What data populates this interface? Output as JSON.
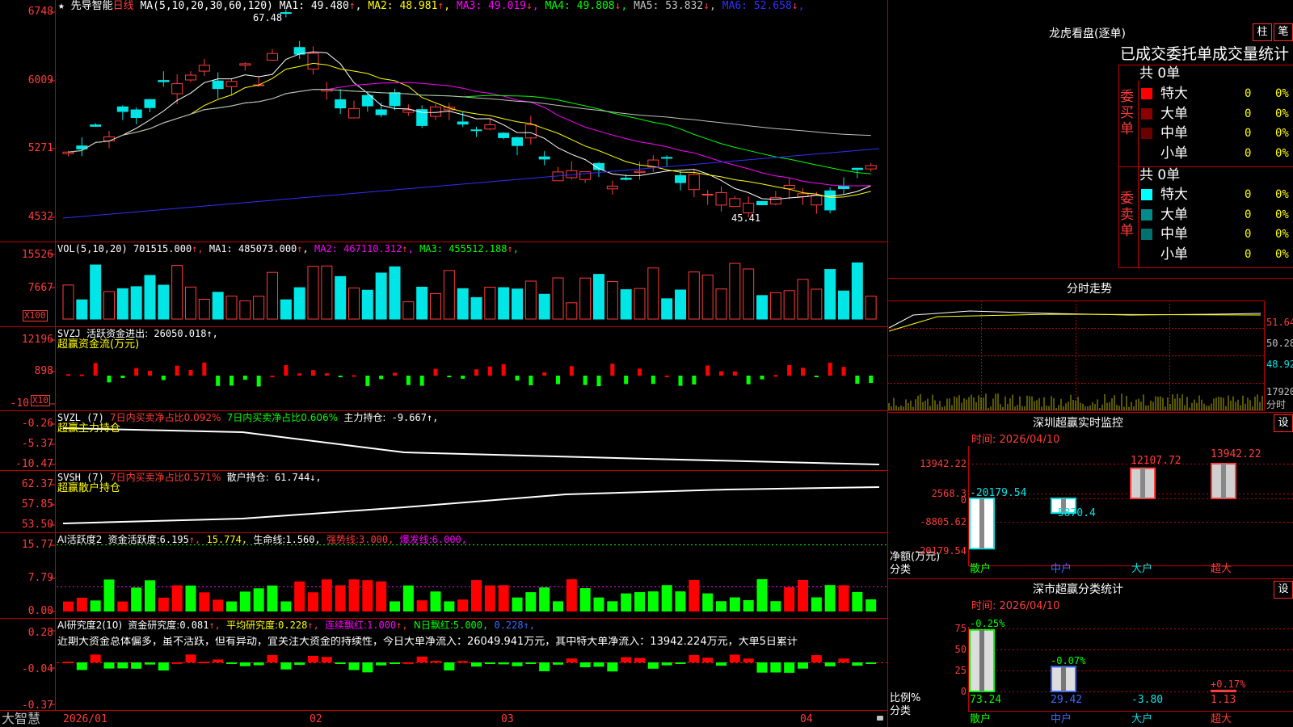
{
  "colors": {
    "up": "#ff3b3b",
    "down": "#00e5e5",
    "grid": "#c00000",
    "ma1": "#ffffff",
    "ma2": "#ffff00",
    "ma3": "#ff00ff",
    "ma4": "#00ff00",
    "ma5": "#c0c0c0",
    "ma6": "#3030ff"
  },
  "main": {
    "axis": [
      "6748",
      "6009",
      "5271",
      "4532"
    ],
    "star": "★",
    "title": "先导智能",
    "period": "日线",
    "ma_head": "MA(5,10,20,30,60,120)",
    "ma": [
      {
        "label": "MA1:",
        "value": "49.480",
        "arrow": "↑"
      },
      {
        "label": "MA2:",
        "value": "48.981",
        "arrow": "↑"
      },
      {
        "label": "MA3:",
        "value": "49.019",
        "arrow": "↓"
      },
      {
        "label": "MA4:",
        "value": "49.808",
        "arrow": "↓"
      },
      {
        "label": "MA5:",
        "value": "53.832",
        "arrow": "↓"
      },
      {
        "label": "MA6:",
        "value": "52.658",
        "arrow": "↓"
      }
    ],
    "high_mark": "67.48",
    "low_mark": "45.41"
  },
  "vol": {
    "axis": [
      "15526",
      "7667"
    ],
    "multiplier": "X100",
    "head": "VOL(5,10,20)",
    "value": "701515.000",
    "ma": [
      {
        "label": "MA1:",
        "value": "485073.000",
        "arrow": "↑"
      },
      {
        "label": "MA2:",
        "value": "467110.312",
        "arrow": "↑"
      },
      {
        "label": "MA3:",
        "value": "455512.188",
        "arrow": "↑"
      }
    ]
  },
  "svzj": {
    "axis": [
      "12196",
      "898",
      "-10"
    ],
    "multiplier": "X10",
    "head": "SVZJ",
    "label": "活跃资金进出:",
    "value": "26050.018",
    "arrow": "↑,",
    "sub": "超赢资金流(万元)"
  },
  "svzl": {
    "axis": [
      "-0.26",
      "-5.37",
      "-10.47"
    ],
    "head": "SVZL (7)",
    "t1": "7日内买卖净占比0.092%",
    "t2": "7日内买卖净占比0.606%",
    "label": "主力持仓:",
    "value": "-9.667",
    "arrow": "↑,",
    "sub": "超赢主力持仓"
  },
  "svsh": {
    "axis": [
      "62.37",
      "57.85",
      "53.50"
    ],
    "head": "SVSH (7)",
    "t1": "7日内买卖净占比0.571%",
    "label": "散户持仓:",
    "value": "61.744",
    "arrow": "↓,",
    "sub": "超赢散户持仓"
  },
  "ai1": {
    "axis": [
      "15.77",
      "7.79",
      "0.00"
    ],
    "head": "AI活跃度2",
    "l1": "资金活跃度:",
    "v1": "6.195",
    "a1": "↑,",
    "v2": "15.774",
    "a2": ",",
    "l3": "生命线:",
    "v3": "1.560",
    "a3": ",",
    "l4": "强势线:",
    "v4": "3.000",
    "a4": ",",
    "l5": "爆发线:",
    "v5": "6.000",
    "a5": ","
  },
  "ai2": {
    "axis": [
      "0.28",
      "-0.04",
      "-0.37"
    ],
    "head": "AI研究度2(10)",
    "l1": "资金研究度:",
    "v1": "0.081",
    "a1": "↑,",
    "l2": "平均研究度:",
    "v2": "0.228",
    "a2": "↑,",
    "l3": "连续飘红:",
    "v3": "1.000",
    "a3": "↑,",
    "l4": "N日飘红:",
    "v4": "5.000",
    "a4": ",",
    "v5": "0.228",
    "a5": "↑,",
    "note": "近期大资金总体偏多，虽不活跃，但有异动，宜关注大资金的持续性，今日大单净流入：26049.941万元，其中特大单净流入：13942.224万元，大单5日累计"
  },
  "xaxis": {
    "brand": "大智慧",
    "labels": [
      "2026/01",
      "02",
      "03",
      "04"
    ]
  },
  "lhb": {
    "title": "龙虎看盘(逐单)",
    "btn_zhu": "柱",
    "btn_bi": "笔",
    "header": "已成交委托单成交量统计",
    "buy_label": "委买单",
    "sell_label": "委卖单",
    "buy_total": "共 0单",
    "sell_total": "共 0单",
    "buy_rows": [
      {
        "name": "特大",
        "count": "0",
        "pct": "0%",
        "color": "#ff0000"
      },
      {
        "name": "大单",
        "count": "0",
        "pct": "0%",
        "color": "#8b0000"
      },
      {
        "name": "中单",
        "count": "0",
        "pct": "0%",
        "color": "#6b0000"
      },
      {
        "name": "小单",
        "count": "0",
        "pct": "0%",
        "color": ""
      }
    ],
    "sell_rows": [
      {
        "name": "特大",
        "count": "0",
        "pct": "0%",
        "color": "#00ffff"
      },
      {
        "name": "大单",
        "count": "0",
        "pct": "0%",
        "color": "#008b8b"
      },
      {
        "name": "中单",
        "count": "0",
        "pct": "0%",
        "color": "#007070"
      },
      {
        "name": "小单",
        "count": "0",
        "pct": "0%",
        "color": ""
      }
    ]
  },
  "fenshi": {
    "title": "分时走势",
    "axis": [
      "51.64",
      "50.28",
      "48.92",
      "17920"
    ],
    "unit": "分时"
  },
  "sz_monitor": {
    "title": "深圳超赢实时监控",
    "set": "设",
    "time": "时间: 2026/04/10",
    "axis": [
      "13942.22",
      "2568.3",
      "0",
      "-8805.62",
      "-20179.54"
    ],
    "ylabel": "净额(万元)",
    "xlabel": "分类",
    "categories": [
      "散户",
      "中户",
      "大户",
      "超大"
    ],
    "values": [
      -20179.54,
      -5870.4,
      12107.72,
      13942.22
    ],
    "value_labels": [
      "-20179.54",
      "-5870.4",
      "12107.72",
      "13942.22"
    ]
  },
  "sz_class": {
    "title": "深市超赢分类统计",
    "set": "设",
    "time": "时间: 2026/04/10",
    "axis": [
      "75",
      "50",
      "25",
      "0"
    ],
    "ylabel": "比例%",
    "xlabel": "分类",
    "categories": [
      "散户",
      "中户",
      "大户",
      "超大"
    ],
    "values": [
      73.24,
      29.42,
      -3.8,
      1.13
    ],
    "value_labels": [
      "73.24",
      "29.42",
      "-3.80",
      "1.13"
    ],
    "changes": [
      "-0.25%",
      "-0.07%",
      "",
      "+0.17%"
    ]
  }
}
